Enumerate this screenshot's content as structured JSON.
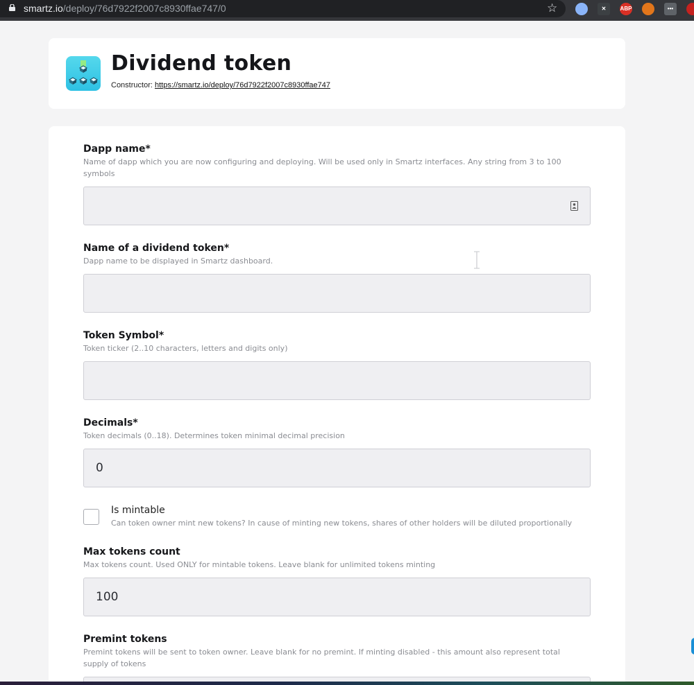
{
  "browser": {
    "url_host": "smartz.io",
    "url_path": "/deploy/76d7922f2007c8930ffae747/0",
    "extensions": [
      {
        "name": "extension-1-icon",
        "color": "#8ab4f8",
        "text": ""
      },
      {
        "name": "extension-2-icon",
        "color": "#3c4043",
        "text": "✕"
      },
      {
        "name": "adblock-icon",
        "color": "#d93025",
        "text": "ABP"
      },
      {
        "name": "metamask-icon",
        "color": "#e2761b",
        "text": ""
      },
      {
        "name": "extension-menu-icon",
        "color": "#5f6368",
        "text": "•••"
      },
      {
        "name": "extension-6-icon",
        "color": "#c5221f",
        "text": ""
      }
    ]
  },
  "header": {
    "title": "Dividend token",
    "constructor_label": "Constructor:",
    "constructor_link": "https://smartz.io/deploy/76d7922f2007c8930ffae747"
  },
  "form": {
    "dapp_name": {
      "label": "Dapp name*",
      "description": "Name of dapp which you are now configuring and deploying. Will be used only in Smartz interfaces. Any string from 3 to 100 symbols",
      "value": ""
    },
    "token_name": {
      "label": "Name of a dividend token*",
      "description": "Dapp name to be displayed in Smartz dashboard.",
      "value": ""
    },
    "token_symbol": {
      "label": "Token Symbol*",
      "description": "Token ticker (2..10 characters, letters and digits only)",
      "value": ""
    },
    "decimals": {
      "label": "Decimals*",
      "description": "Token decimals (0..18). Determines token minimal decimal precision",
      "value": "0"
    },
    "is_mintable": {
      "label": "Is mintable",
      "description": "Can token owner mint new tokens? In cause of minting new tokens, shares of other holders will be diluted proportionally",
      "checked": false
    },
    "max_tokens": {
      "label": "Max tokens count",
      "description": "Max tokens count. Used ONLY for mintable tokens. Leave blank for unlimited tokens minting",
      "value": "100"
    },
    "premint": {
      "label": "Premint tokens",
      "description": "Premint tokens will be sent to token owner. Leave blank for no premint. If minting disabled - this amount also represent total supply of tokens",
      "value": ""
    }
  }
}
